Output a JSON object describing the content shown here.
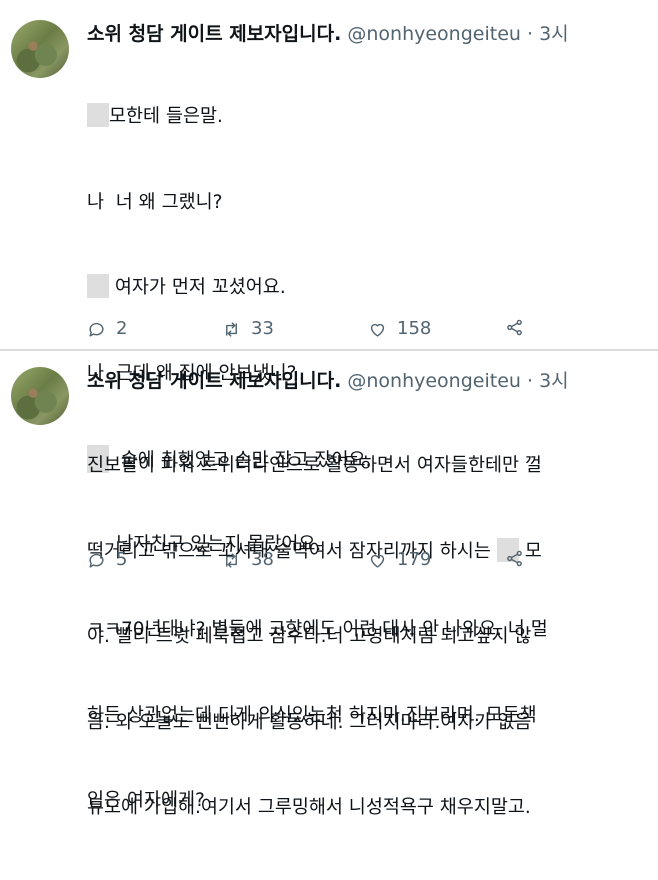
{
  "tweets": [
    {
      "author": {
        "name": "소위 청담 게이트 제보자입니다.",
        "handle": "@nonhyeongeiteu",
        "separator": "·",
        "time": "3시"
      },
      "lines": [
        {
          "redacted": true,
          "text": "모한테 들은말."
        },
        {
          "redacted": false,
          "text": "나  너 왜 그랬니?"
        },
        {
          "redacted": true,
          "text": " 여자가 먼저 꼬셨어요."
        },
        {
          "redacted": false,
          "text": "나  근데 왜 집에 안보냈니?"
        },
        {
          "redacted": true,
          "text": "  술에 취했었고 손만 잡고 잤어요."
        },
        {
          "redacted": false,
          "text": "     남자친구 있는지 몰랐어요."
        },
        {
          "redacted": false,
          "text": "ㅋㅋ70년대냐? 별들에 고향에도 이런 대사 안 나와요. 너 멀"
        },
        {
          "redacted": false,
          "text": "하든 상관없는데 디게 의식있는척 하지마.진보라며. 모든책"
        },
        {
          "redacted": false,
          "text": "임은 여자에게?"
        }
      ],
      "actions": {
        "reply_count": "2",
        "retweet_count": "33",
        "like_count": "158"
      }
    },
    {
      "author": {
        "name": "소위 청담 게이트 제보자입니다.",
        "handle": "@nonhyeongeiteu",
        "separator": "·",
        "time": "3시"
      },
      "lines": [
        {
          "text": "진보팔이 파워 트위터라인으로 활동하면서 여자들한테만 껄"
        },
        {
          "text_before": "떡거리고 밖으로 꼬셔내 술먹여서 잠자리까지 하시는",
          "text_after": " 모"
        },
        {
          "text": "야. 빨리 트윗 페북접고 잠수타.너 고영태처럼 되고싶지 않"
        },
        {
          "text": "음. 와 오늘도 뻔뻔하게 활동하네. 그러지마라.여자가 없음"
        },
        {
          "text": "듀오에 가입해.여기서 그루밍해서 니성적욕구 채우지말고."
        }
      ],
      "actions": {
        "reply_count": "5",
        "retweet_count": "38",
        "like_count": "179"
      }
    }
  ],
  "icons": {
    "reply": "speech-bubble-icon",
    "retweet": "retweet-arrows-icon",
    "like": "heart-icon",
    "share": "share-nodes-icon"
  },
  "colors": {
    "text": "#0f1419",
    "secondary": "#536471",
    "redaction": "#dedede"
  }
}
